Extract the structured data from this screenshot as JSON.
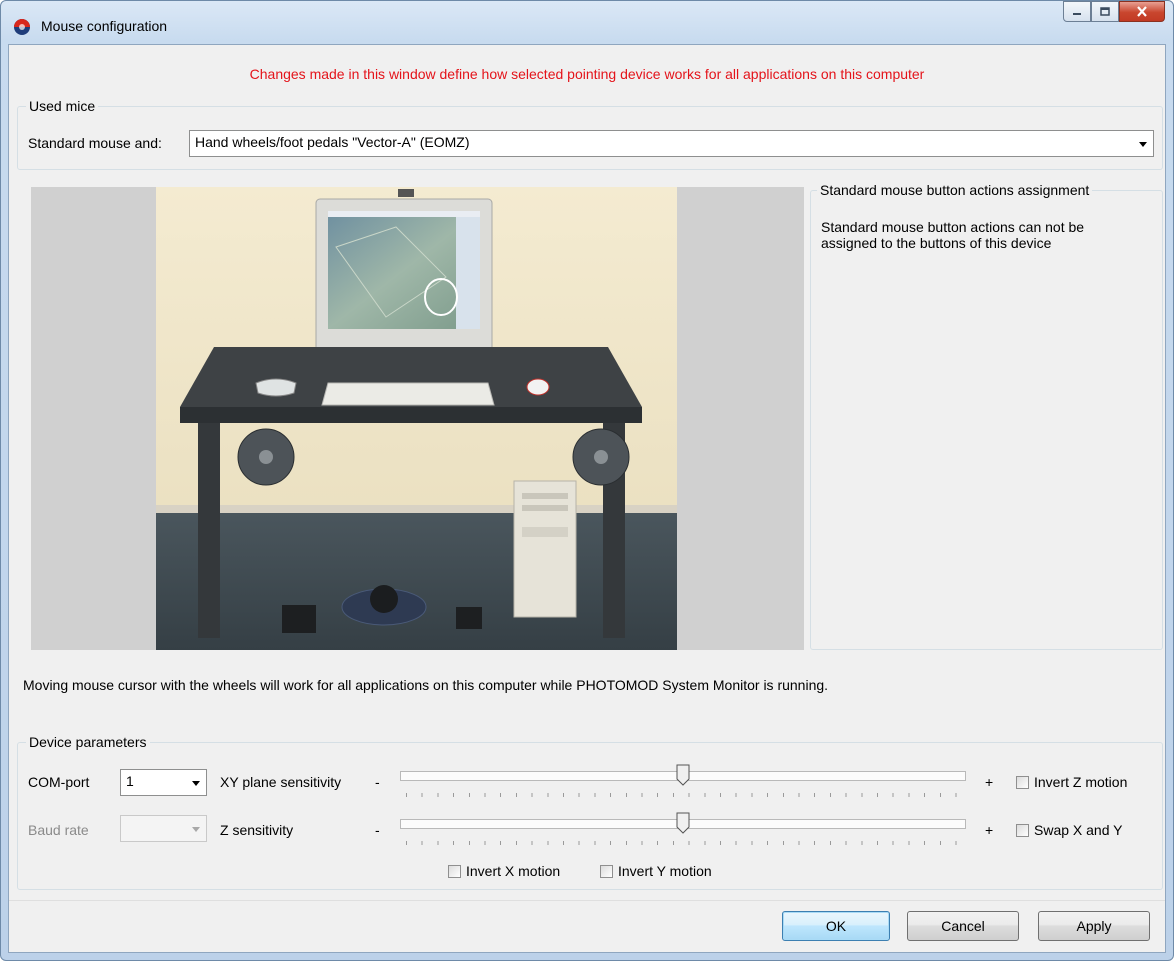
{
  "window": {
    "title": "Mouse configuration",
    "controls": [
      "minimize-icon",
      "maximize-icon",
      "close-icon"
    ]
  },
  "notice": "Changes made in this window define how selected pointing device works for all applications on this computer",
  "used_mice": {
    "legend": "Used mice",
    "label": "Standard mouse and:",
    "selected": "Hand wheels/foot pedals \"Vector-A\" (EOMZ)"
  },
  "button_actions": {
    "legend": "Standard mouse button actions assignment",
    "message": "Standard mouse button actions can not be assigned to the buttons of this device"
  },
  "info_text": "Moving mouse cursor with the wheels will work for all applications on this computer while PHOTOMOD System Monitor is running.",
  "device_params": {
    "legend": "Device parameters",
    "com_port_label": "COM-port",
    "com_port_value": "1",
    "baud_rate_label": "Baud rate",
    "baud_rate_value": "",
    "xy_label": "XY plane sensitivity",
    "z_label": "Z sensitivity",
    "minus": "-",
    "plus": "+",
    "xy_sensitivity": 0.5,
    "z_sensitivity": 0.5,
    "invert_z": "Invert Z motion",
    "swap_xy": "Swap X and Y",
    "invert_x": "Invert X motion",
    "invert_y": "Invert Y motion"
  },
  "buttons": {
    "ok": "OK",
    "cancel": "Cancel",
    "apply": "Apply"
  },
  "colors": {
    "notice": "#e4131a",
    "dialog_bg": "#f0f0f0",
    "photo_wall": "#efe5c8",
    "photo_floor": "#3d4a52"
  }
}
